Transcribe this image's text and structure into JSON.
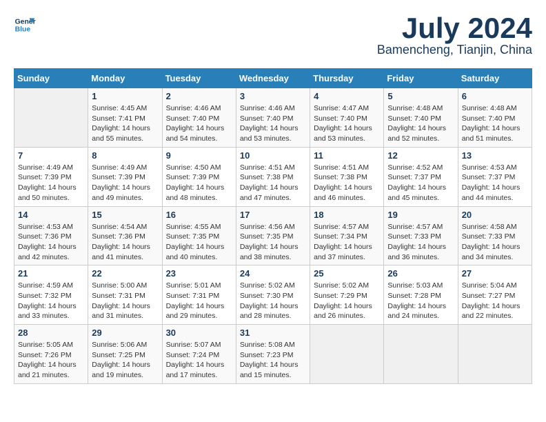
{
  "header": {
    "logo_line1": "General",
    "logo_line2": "Blue",
    "month": "July 2024",
    "location": "Bamencheng, Tianjin, China"
  },
  "weekdays": [
    "Sunday",
    "Monday",
    "Tuesday",
    "Wednesday",
    "Thursday",
    "Friday",
    "Saturday"
  ],
  "weeks": [
    [
      {
        "day": "",
        "sunrise": "",
        "sunset": "",
        "daylight": ""
      },
      {
        "day": "1",
        "sunrise": "Sunrise: 4:45 AM",
        "sunset": "Sunset: 7:41 PM",
        "daylight": "Daylight: 14 hours and 55 minutes."
      },
      {
        "day": "2",
        "sunrise": "Sunrise: 4:46 AM",
        "sunset": "Sunset: 7:40 PM",
        "daylight": "Daylight: 14 hours and 54 minutes."
      },
      {
        "day": "3",
        "sunrise": "Sunrise: 4:46 AM",
        "sunset": "Sunset: 7:40 PM",
        "daylight": "Daylight: 14 hours and 53 minutes."
      },
      {
        "day": "4",
        "sunrise": "Sunrise: 4:47 AM",
        "sunset": "Sunset: 7:40 PM",
        "daylight": "Daylight: 14 hours and 53 minutes."
      },
      {
        "day": "5",
        "sunrise": "Sunrise: 4:48 AM",
        "sunset": "Sunset: 7:40 PM",
        "daylight": "Daylight: 14 hours and 52 minutes."
      },
      {
        "day": "6",
        "sunrise": "Sunrise: 4:48 AM",
        "sunset": "Sunset: 7:40 PM",
        "daylight": "Daylight: 14 hours and 51 minutes."
      }
    ],
    [
      {
        "day": "7",
        "sunrise": "Sunrise: 4:49 AM",
        "sunset": "Sunset: 7:39 PM",
        "daylight": "Daylight: 14 hours and 50 minutes."
      },
      {
        "day": "8",
        "sunrise": "Sunrise: 4:49 AM",
        "sunset": "Sunset: 7:39 PM",
        "daylight": "Daylight: 14 hours and 49 minutes."
      },
      {
        "day": "9",
        "sunrise": "Sunrise: 4:50 AM",
        "sunset": "Sunset: 7:39 PM",
        "daylight": "Daylight: 14 hours and 48 minutes."
      },
      {
        "day": "10",
        "sunrise": "Sunrise: 4:51 AM",
        "sunset": "Sunset: 7:38 PM",
        "daylight": "Daylight: 14 hours and 47 minutes."
      },
      {
        "day": "11",
        "sunrise": "Sunrise: 4:51 AM",
        "sunset": "Sunset: 7:38 PM",
        "daylight": "Daylight: 14 hours and 46 minutes."
      },
      {
        "day": "12",
        "sunrise": "Sunrise: 4:52 AM",
        "sunset": "Sunset: 7:37 PM",
        "daylight": "Daylight: 14 hours and 45 minutes."
      },
      {
        "day": "13",
        "sunrise": "Sunrise: 4:53 AM",
        "sunset": "Sunset: 7:37 PM",
        "daylight": "Daylight: 14 hours and 44 minutes."
      }
    ],
    [
      {
        "day": "14",
        "sunrise": "Sunrise: 4:53 AM",
        "sunset": "Sunset: 7:36 PM",
        "daylight": "Daylight: 14 hours and 42 minutes."
      },
      {
        "day": "15",
        "sunrise": "Sunrise: 4:54 AM",
        "sunset": "Sunset: 7:36 PM",
        "daylight": "Daylight: 14 hours and 41 minutes."
      },
      {
        "day": "16",
        "sunrise": "Sunrise: 4:55 AM",
        "sunset": "Sunset: 7:35 PM",
        "daylight": "Daylight: 14 hours and 40 minutes."
      },
      {
        "day": "17",
        "sunrise": "Sunrise: 4:56 AM",
        "sunset": "Sunset: 7:35 PM",
        "daylight": "Daylight: 14 hours and 38 minutes."
      },
      {
        "day": "18",
        "sunrise": "Sunrise: 4:57 AM",
        "sunset": "Sunset: 7:34 PM",
        "daylight": "Daylight: 14 hours and 37 minutes."
      },
      {
        "day": "19",
        "sunrise": "Sunrise: 4:57 AM",
        "sunset": "Sunset: 7:33 PM",
        "daylight": "Daylight: 14 hours and 36 minutes."
      },
      {
        "day": "20",
        "sunrise": "Sunrise: 4:58 AM",
        "sunset": "Sunset: 7:33 PM",
        "daylight": "Daylight: 14 hours and 34 minutes."
      }
    ],
    [
      {
        "day": "21",
        "sunrise": "Sunrise: 4:59 AM",
        "sunset": "Sunset: 7:32 PM",
        "daylight": "Daylight: 14 hours and 33 minutes."
      },
      {
        "day": "22",
        "sunrise": "Sunrise: 5:00 AM",
        "sunset": "Sunset: 7:31 PM",
        "daylight": "Daylight: 14 hours and 31 minutes."
      },
      {
        "day": "23",
        "sunrise": "Sunrise: 5:01 AM",
        "sunset": "Sunset: 7:31 PM",
        "daylight": "Daylight: 14 hours and 29 minutes."
      },
      {
        "day": "24",
        "sunrise": "Sunrise: 5:02 AM",
        "sunset": "Sunset: 7:30 PM",
        "daylight": "Daylight: 14 hours and 28 minutes."
      },
      {
        "day": "25",
        "sunrise": "Sunrise: 5:02 AM",
        "sunset": "Sunset: 7:29 PM",
        "daylight": "Daylight: 14 hours and 26 minutes."
      },
      {
        "day": "26",
        "sunrise": "Sunrise: 5:03 AM",
        "sunset": "Sunset: 7:28 PM",
        "daylight": "Daylight: 14 hours and 24 minutes."
      },
      {
        "day": "27",
        "sunrise": "Sunrise: 5:04 AM",
        "sunset": "Sunset: 7:27 PM",
        "daylight": "Daylight: 14 hours and 22 minutes."
      }
    ],
    [
      {
        "day": "28",
        "sunrise": "Sunrise: 5:05 AM",
        "sunset": "Sunset: 7:26 PM",
        "daylight": "Daylight: 14 hours and 21 minutes."
      },
      {
        "day": "29",
        "sunrise": "Sunrise: 5:06 AM",
        "sunset": "Sunset: 7:25 PM",
        "daylight": "Daylight: 14 hours and 19 minutes."
      },
      {
        "day": "30",
        "sunrise": "Sunrise: 5:07 AM",
        "sunset": "Sunset: 7:24 PM",
        "daylight": "Daylight: 14 hours and 17 minutes."
      },
      {
        "day": "31",
        "sunrise": "Sunrise: 5:08 AM",
        "sunset": "Sunset: 7:23 PM",
        "daylight": "Daylight: 14 hours and 15 minutes."
      },
      {
        "day": "",
        "sunrise": "",
        "sunset": "",
        "daylight": ""
      },
      {
        "day": "",
        "sunrise": "",
        "sunset": "",
        "daylight": ""
      },
      {
        "day": "",
        "sunrise": "",
        "sunset": "",
        "daylight": ""
      }
    ]
  ]
}
